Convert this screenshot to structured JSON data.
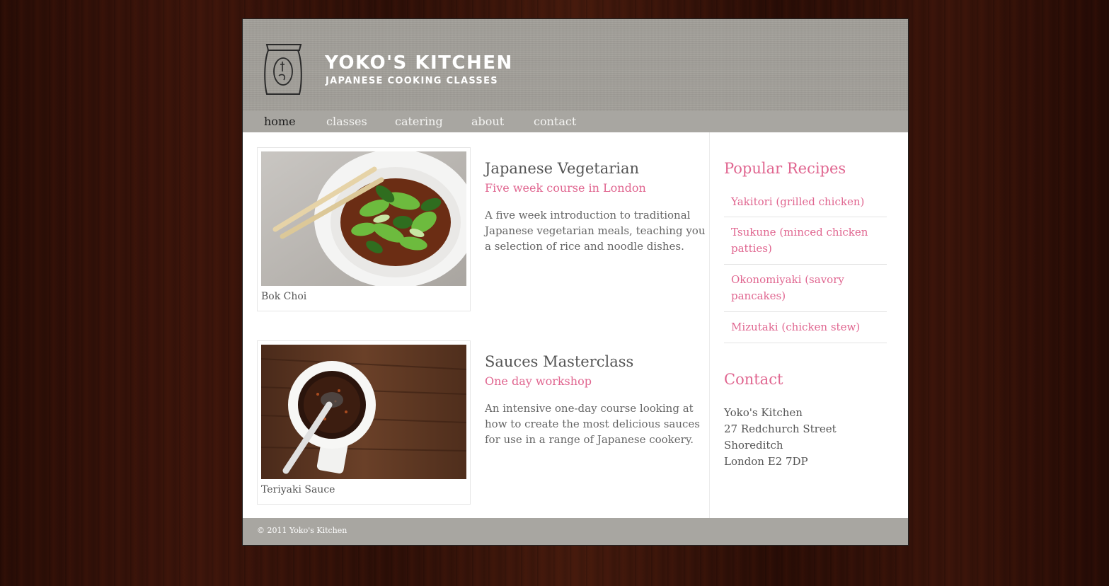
{
  "brand": {
    "name": "YOKO'S KITCHEN",
    "tagline": "JAPANESE COOKING CLASSES",
    "logo_icon": "tea-canister-icon"
  },
  "nav": {
    "items": [
      {
        "label": "home",
        "active": true
      },
      {
        "label": "classes",
        "active": false
      },
      {
        "label": "catering",
        "active": false
      },
      {
        "label": "about",
        "active": false
      },
      {
        "label": "contact",
        "active": false
      }
    ]
  },
  "courses": [
    {
      "image_caption": "Bok Choi",
      "title": "Japanese Vegetarian",
      "subtitle": "Five week course in London",
      "description": "A five week introduction to traditional Japanese vegetarian meals, teaching you a selection of rice and noodle dishes."
    },
    {
      "image_caption": "Teriyaki Sauce",
      "title": "Sauces Masterclass",
      "subtitle": "One day workshop",
      "description": "An intensive one-day course looking at how to create the most delicious sauces for use in a range of Japanese cookery."
    }
  ],
  "sidebar": {
    "popular_heading": "Popular Recipes",
    "recipes": [
      "Yakitori (grilled chicken)",
      "Tsukune (minced chicken patties)",
      "Okonomiyaki (savory pancakes)",
      "Mizutaki (chicken stew)"
    ],
    "contact_heading": "Contact",
    "contact_lines": [
      "Yoko's Kitchen",
      "27 Redchurch Street",
      "Shoreditch",
      "London E2 7DP"
    ]
  },
  "footer": {
    "copyright": "© 2011 Yoko's Kitchen"
  },
  "colors": {
    "accent_pink": "#e06690",
    "header_gray": "#a29f99",
    "nav_gray": "#a8a6a1",
    "wood_brown": "#3d150b"
  }
}
